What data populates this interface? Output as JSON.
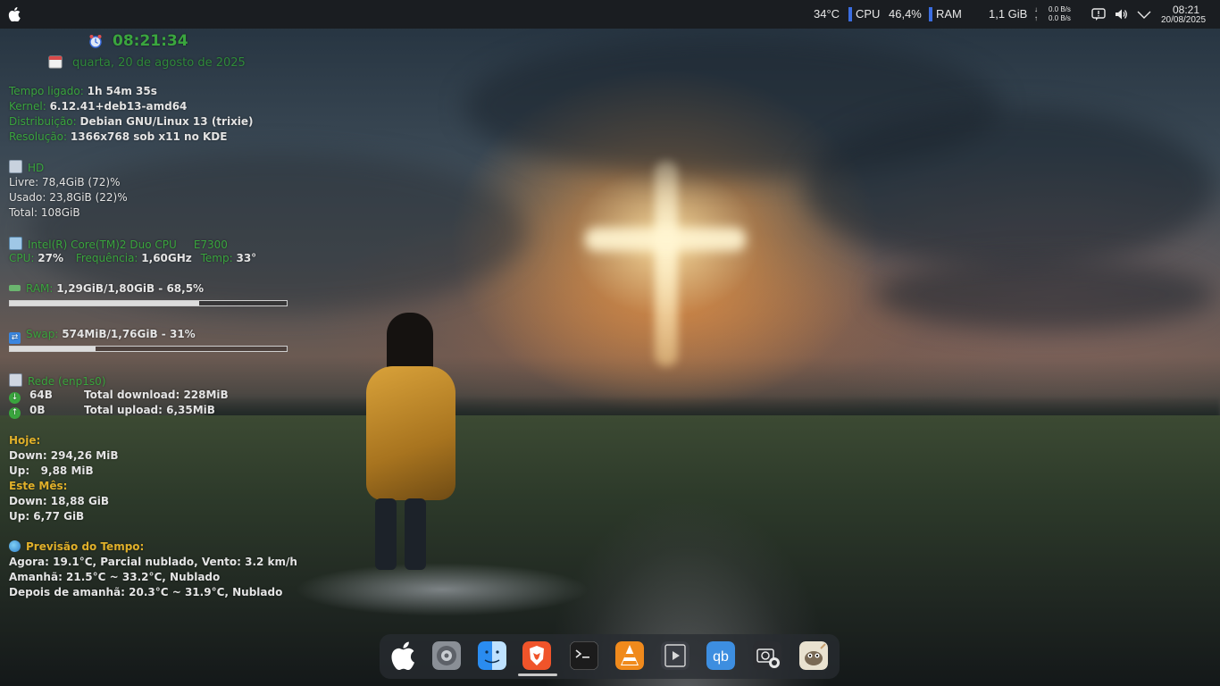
{
  "top_panel": {
    "app_menu_icon": "apple-logo-icon",
    "temperature": "34°C",
    "cpu_label": "CPU",
    "cpu_value": "46,4%",
    "ram_label": "RAM",
    "ram_value": "1,1 GiB",
    "net_down": "0.0 B/s",
    "net_up": "0.0 B/s",
    "tray_icons": [
      "notification-icon",
      "volume-icon",
      "chevron-down-icon"
    ],
    "clock_time": "08:21",
    "clock_date": "20/08/2025",
    "accent_color": "#3b6de0"
  },
  "conky": {
    "time": "08:21:34",
    "date": "quarta, 20 de agosto de 2025",
    "uptime_label": "Tempo ligado:",
    "uptime_value": "1h 54m 35s",
    "kernel_label": "Kernel:",
    "kernel_value": "6.12.41+deb13-amd64",
    "distro_label": "Distribuição:",
    "distro_value": "Debian GNU/Linux 13 (trixie)",
    "resolution_label": "Resolução:",
    "resolution_value": "1366x768 sob x11 no KDE",
    "hd_label": "HD",
    "hd_free": "Livre: 78,4GiB (72)%",
    "hd_used": "Usado: 23,8GiB (22)%",
    "hd_total": "Total: 108GiB",
    "cpu_model": "Intel(R) Core(TM)2 Duo CPU     E7300",
    "cpu_label": "CPU:",
    "cpu_value": "27%",
    "freq_label": "Frequência:",
    "freq_value": "1,60GHz",
    "temp_label": "Temp:",
    "temp_value": "33°",
    "ram_label": "RAM:",
    "ram_value": "1,29GiB/1,80GiB - 68,5%",
    "ram_fraction": 0.685,
    "swap_label": "Swap:",
    "swap_value": "574MiB/1,76GiB - 31%",
    "swap_fraction": 0.31,
    "net_label": "Rede (enp1s0)",
    "net_down_speed": "64B",
    "net_down_total": "Total download: 228MiB",
    "net_up_speed": "0B",
    "net_up_total": "Total upload: 6,35MiB",
    "today_label": "Hoje:",
    "today_down": "Down: 294,26 MiB",
    "today_up": "Up:   9,88 MiB",
    "month_label": "Este Mês:",
    "month_down": "Down: 18,88 GiB",
    "month_up": "Up: 6,77 GiB",
    "weather_label": "Previsão do Tempo:",
    "weather_now": "Agora: 19.1°C, Parcial nublado, Vento: 3.2 km/h",
    "weather_tomorrow": "Amanhã: 21.5°C ~ 33.2°C, Nublado",
    "weather_after": "Depois de amanhã: 20.3°C ~ 31.9°C, Nublado",
    "label_color": "#3aa53e",
    "heading_color": "#e0b02a"
  },
  "dock": {
    "items": [
      {
        "name": "apple-menu-icon",
        "color": "#ffffff"
      },
      {
        "name": "system-settings-icon",
        "color": "#8a8f96"
      },
      {
        "name": "finder-icon",
        "color": "#2a8cf0"
      },
      {
        "name": "brave-browser-icon",
        "color": "#f0542a"
      },
      {
        "name": "terminal-icon",
        "color": "#1c1c1c"
      },
      {
        "name": "vlc-icon",
        "color": "#f08a1c"
      },
      {
        "name": "video-editor-icon",
        "color": "#3a3d44"
      },
      {
        "name": "qbittorrent-icon",
        "color": "#3d8ee0"
      },
      {
        "name": "screenshot-icon",
        "color": "#2b2d31"
      },
      {
        "name": "gimp-icon",
        "color": "#e9e2d0"
      }
    ]
  }
}
